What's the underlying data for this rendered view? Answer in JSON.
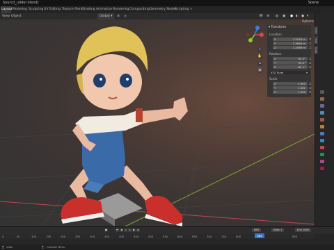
{
  "window": {
    "title": "Sourcd_udder.blend]",
    "scene_label": "Scene"
  },
  "workspaces": [
    "Layout",
    "Modeling",
    "Sculpting",
    "UV Editing",
    "Texture Paint",
    "Shading",
    "Animation",
    "Rendering",
    "Compositing",
    "Geometry Nodes",
    "Scripting",
    "+"
  ],
  "active_workspace": "Layout",
  "viewport_header": {
    "menu": [
      "View",
      "Object"
    ],
    "transform_orientation": "Global",
    "options_label": "Options"
  },
  "npanel": {
    "title": "Transform",
    "location_label": "Location",
    "location": [
      {
        "axis": "X",
        "value": "1.5078 m"
      },
      {
        "axis": "Y",
        "value": "2.3650 m"
      },
      {
        "axis": "Z",
        "value": "1.2598 m"
      }
    ],
    "rotation_label": "Rotation",
    "rotation": [
      {
        "axis": "X",
        "value": "61.2°"
      },
      {
        "axis": "Y",
        "value": "90.5°"
      },
      {
        "axis": "Z",
        "value": "-82.1°"
      }
    ],
    "rotation_mode": "XYZ Euler",
    "scale_label": "Scale",
    "scale": [
      {
        "axis": "X",
        "value": "1.000"
      },
      {
        "axis": "Y",
        "value": "1.000"
      },
      {
        "axis": "Z",
        "value": "1.000"
      }
    ],
    "tabs": [
      "Item",
      "Tool",
      "View"
    ]
  },
  "timeline": {
    "start_label": "Start",
    "start": "1",
    "end_label": "End",
    "end": "1600",
    "current_frame": "888",
    "ticks": [
      "0",
      "50",
      "100",
      "150",
      "200",
      "250",
      "300",
      "350",
      "400",
      "450",
      "500",
      "550",
      "600",
      "650",
      "700",
      "750",
      "800",
      "850"
    ]
  },
  "status": {
    "left": "View",
    "middle": "Context Menu"
  },
  "colors": {
    "accent": "#3d6fd4",
    "x_axis": "#e0444e",
    "y_axis": "#8bcc29",
    "z_axis": "#3a7fe6"
  }
}
